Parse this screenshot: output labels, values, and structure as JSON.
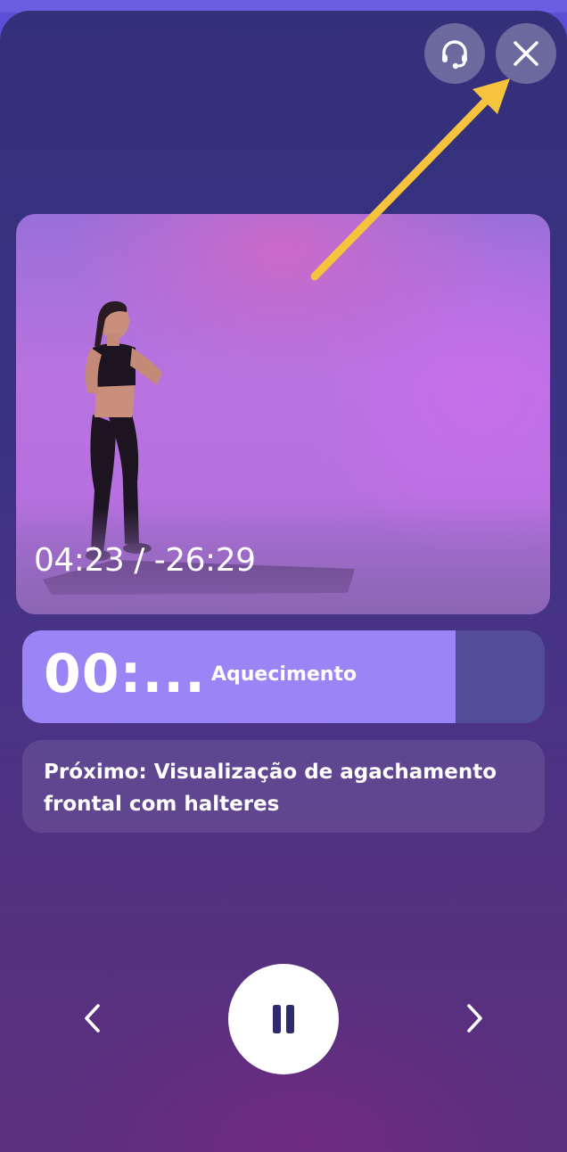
{
  "header": {
    "support_icon": "headset-icon",
    "close_icon": "close-icon"
  },
  "video": {
    "time_display": "04:23 / -26:29"
  },
  "timer": {
    "value": "00:...",
    "label": "Aquecimento",
    "progress_fraction": 0.83,
    "fill_color": "#9b84f5",
    "track_color": "#534c96"
  },
  "up_next": {
    "text": "Próximo: Visualização de agachamento frontal com halteres"
  },
  "controls": {
    "prev_icon": "chevron-left-icon",
    "pause_icon": "pause-icon",
    "next_icon": "chevron-right-icon"
  },
  "annotation": {
    "arrow_color": "#f6c33d"
  },
  "colors": {
    "background_top": "#33307a",
    "background_bottom": "#5a2f7e",
    "accent": "#9b84f5"
  }
}
